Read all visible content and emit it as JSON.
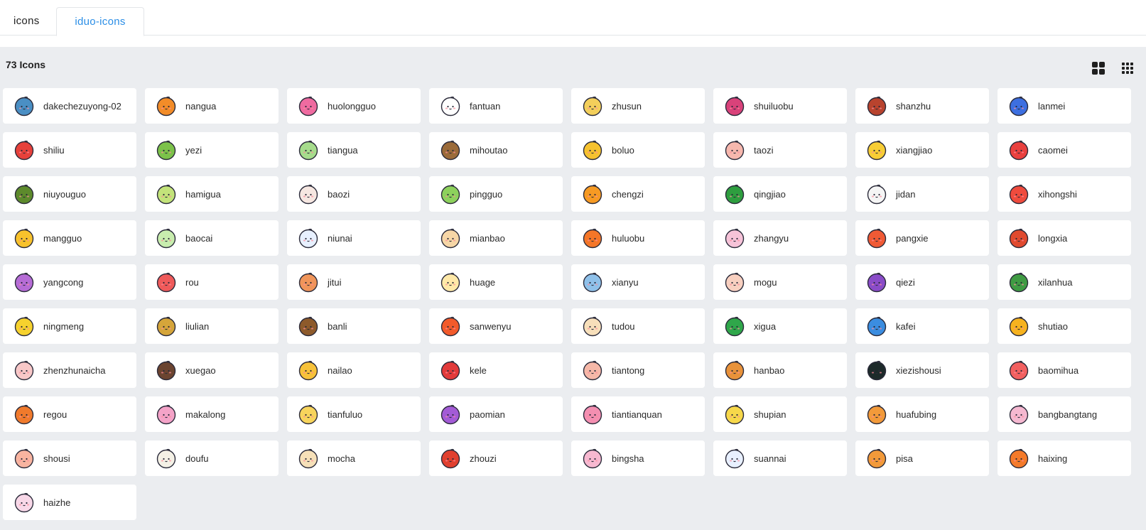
{
  "tabs": [
    {
      "label": "icons",
      "active": false
    },
    {
      "label": "iduo-icons",
      "active": true
    }
  ],
  "toolbar": {
    "count_label": "73 Icons",
    "view_large_icon": "grid-large-icon",
    "view_small_icon": "grid-small-icon"
  },
  "icons": [
    {
      "name": "dakechezuyong-02",
      "color": "#4a8fc4"
    },
    {
      "name": "nangua",
      "color": "#f28c28"
    },
    {
      "name": "huolongguo",
      "color": "#ef6ba0"
    },
    {
      "name": "fantuan",
      "color": "#ffffff"
    },
    {
      "name": "zhusun",
      "color": "#f3cf5b"
    },
    {
      "name": "shuiluobu",
      "color": "#d9427a"
    },
    {
      "name": "shanzhu",
      "color": "#b8432e"
    },
    {
      "name": "lanmei",
      "color": "#3d6fe0"
    },
    {
      "name": "shiliu",
      "color": "#e7413b"
    },
    {
      "name": "yezi",
      "color": "#7cc24a"
    },
    {
      "name": "tiangua",
      "color": "#a6dc8c"
    },
    {
      "name": "mihoutao",
      "color": "#9b6b3a"
    },
    {
      "name": "boluo",
      "color": "#f6c22f"
    },
    {
      "name": "taozi",
      "color": "#f7b8ae"
    },
    {
      "name": "xiangjiao",
      "color": "#f7cd35"
    },
    {
      "name": "caomei",
      "color": "#e9403e"
    },
    {
      "name": "niuyouguo",
      "color": "#5d8a2c"
    },
    {
      "name": "hamigua",
      "color": "#c3e37a"
    },
    {
      "name": "baozi",
      "color": "#f6e7e1"
    },
    {
      "name": "pingguo",
      "color": "#8dd15c"
    },
    {
      "name": "chengzi",
      "color": "#f69a23"
    },
    {
      "name": "qingjiao",
      "color": "#2e9e3f"
    },
    {
      "name": "jidan",
      "color": "#f5f5f5"
    },
    {
      "name": "xihongshi",
      "color": "#ef4b3d"
    },
    {
      "name": "mangguo",
      "color": "#f8c22c"
    },
    {
      "name": "baocai",
      "color": "#c8edae"
    },
    {
      "name": "niunai",
      "color": "#e7f0ff"
    },
    {
      "name": "mianbao",
      "color": "#f6d6a6"
    },
    {
      "name": "huluobu",
      "color": "#f47628"
    },
    {
      "name": "zhangyu",
      "color": "#f6c3d8"
    },
    {
      "name": "pangxie",
      "color": "#f05a35"
    },
    {
      "name": "longxia",
      "color": "#e04a2f"
    },
    {
      "name": "yangcong",
      "color": "#b66cd6"
    },
    {
      "name": "rou",
      "color": "#ef5a5a"
    },
    {
      "name": "jitui",
      "color": "#f0955a"
    },
    {
      "name": "huage",
      "color": "#ffe9a8"
    },
    {
      "name": "xianyu",
      "color": "#8fc1ea"
    },
    {
      "name": "mogu",
      "color": "#f8d0c0"
    },
    {
      "name": "qiezi",
      "color": "#8a4cc8"
    },
    {
      "name": "xilanhua",
      "color": "#3f9b43"
    },
    {
      "name": "ningmeng",
      "color": "#f6d22e"
    },
    {
      "name": "liulian",
      "color": "#d5a53a"
    },
    {
      "name": "banli",
      "color": "#8d5a2b"
    },
    {
      "name": "sanwenyu",
      "color": "#f25a2b"
    },
    {
      "name": "tudou",
      "color": "#f7dfba"
    },
    {
      "name": "xigua",
      "color": "#2fa74a"
    },
    {
      "name": "kafei",
      "color": "#3b8de0"
    },
    {
      "name": "shutiao",
      "color": "#f6b21f"
    },
    {
      "name": "zhenzhunaicha",
      "color": "#f8c8c8"
    },
    {
      "name": "xuegao",
      "color": "#6b4430"
    },
    {
      "name": "nailao",
      "color": "#f7c23a"
    },
    {
      "name": "kele",
      "color": "#e23a3a"
    },
    {
      "name": "tiantong",
      "color": "#f6b8a8"
    },
    {
      "name": "hanbao",
      "color": "#e8923a"
    },
    {
      "name": "xiezishousi",
      "color": "#1d2a2a"
    },
    {
      "name": "baomihua",
      "color": "#f26060"
    },
    {
      "name": "regou",
      "color": "#f07a2c"
    },
    {
      "name": "makalong",
      "color": "#f4a3c8"
    },
    {
      "name": "tianfuluo",
      "color": "#f7d45c"
    },
    {
      "name": "paomian",
      "color": "#a35bd6"
    },
    {
      "name": "tiantianquan",
      "color": "#f48fb1"
    },
    {
      "name": "shupian",
      "color": "#f7d84a"
    },
    {
      "name": "huafubing",
      "color": "#f29a3a"
    },
    {
      "name": "bangbangtang",
      "color": "#f5b8d0"
    },
    {
      "name": "shousi",
      "color": "#f8b4a0"
    },
    {
      "name": "doufu",
      "color": "#f4f1e6"
    },
    {
      "name": "mocha",
      "color": "#f6e0b8"
    },
    {
      "name": "zhouzi",
      "color": "#e0402f"
    },
    {
      "name": "bingsha",
      "color": "#f7b8d0"
    },
    {
      "name": "suannai",
      "color": "#e8f0ff"
    },
    {
      "name": "pisa",
      "color": "#f29a3a"
    },
    {
      "name": "haixing",
      "color": "#f47a2a"
    },
    {
      "name": "haizhe",
      "color": "#f8d8e8"
    }
  ]
}
